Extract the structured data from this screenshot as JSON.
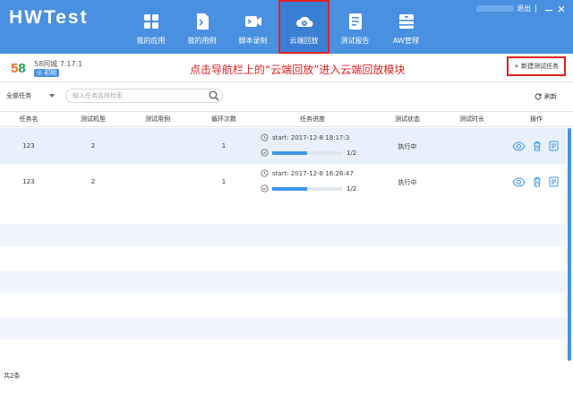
{
  "app": {
    "logo_text": "HWTest",
    "top_right": {
      "logout_label": "退出"
    }
  },
  "nav": {
    "items": [
      {
        "label": "我的应用",
        "icon": "apps-grid-icon"
      },
      {
        "label": "我的用例",
        "icon": "document-script-icon"
      },
      {
        "label": "脚本录制",
        "icon": "video-record-icon"
      },
      {
        "label": "云端回放",
        "icon": "cloud-play-icon",
        "active": true
      },
      {
        "label": "测试报告",
        "icon": "report-icon"
      },
      {
        "label": "AW管理",
        "icon": "cabinet-icon"
      }
    ]
  },
  "subbar": {
    "app_logo_5": "5",
    "app_logo_8": "8",
    "app_name": "58同城 7.17.1",
    "app_badge": "◎ 初始",
    "hint": "点击导航栏上的“云端回放”进入云端回放模块",
    "new_task_label": "+ 新建测试任务"
  },
  "filters": {
    "select_value": "全部任务",
    "search_placeholder": "输入任务名称检索",
    "refresh_label": "刷新"
  },
  "table": {
    "headers": [
      "任务名",
      "测试机型",
      "测试用例",
      "循环次数",
      "任务进度",
      "测试状态",
      "测试时长",
      "操作"
    ],
    "rows": [
      {
        "name": "123",
        "device": "2",
        "case": "",
        "loops": "1",
        "start": "start: 2017-12-8 18:17:3",
        "progress_text": "1/2",
        "progress": 0.5,
        "status": "执行中",
        "duration": ""
      },
      {
        "name": "123",
        "device": "2",
        "case": "",
        "loops": "1",
        "start": "start: 2017-12-8 16:26:47",
        "progress_text": "1/2",
        "progress": 0.5,
        "status": "执行中",
        "duration": ""
      }
    ]
  },
  "footer": {
    "total": "共2条"
  },
  "colors": {
    "header": "#4a90e0",
    "accent_red": "#e02020",
    "progress": "#3c96e8"
  }
}
